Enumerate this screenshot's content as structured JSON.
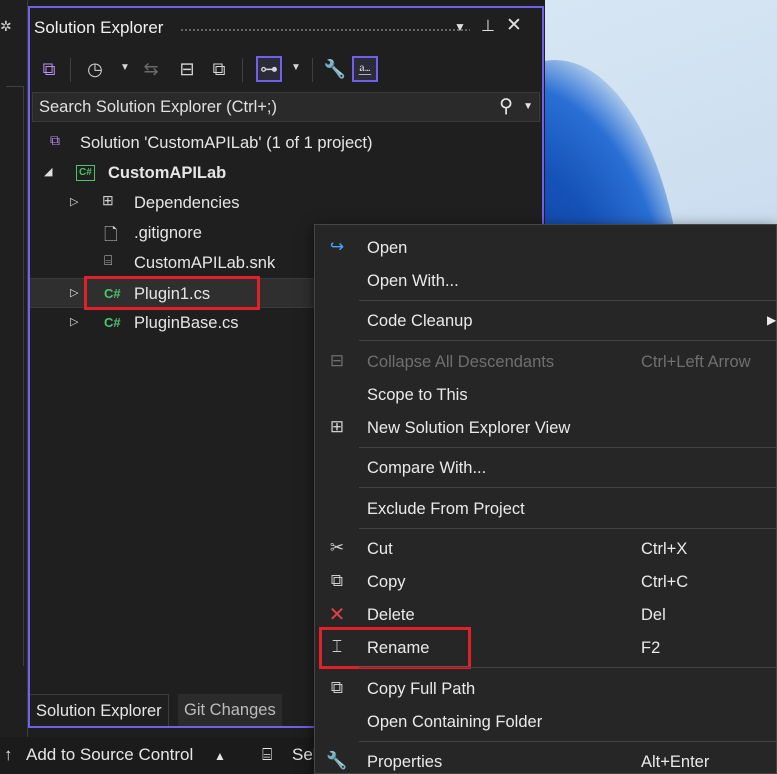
{
  "panel": {
    "title": "Solution Explorer",
    "search_placeholder": "Search Solution Explorer (Ctrl+;)"
  },
  "tree": [
    {
      "label": "Solution 'CustomAPILab' (1 of 1 project)"
    },
    {
      "label": "CustomAPILab"
    },
    {
      "label": "Dependencies"
    },
    {
      "label": ".gitignore"
    },
    {
      "label": "CustomAPILab.snk"
    },
    {
      "label": "Plugin1.cs"
    },
    {
      "label": "PluginBase.cs"
    }
  ],
  "tabs": [
    "Solution Explorer",
    "Git Changes"
  ],
  "status": {
    "add_source": "Add to Source Control",
    "select_repo": "Sel"
  },
  "menu": {
    "open": "Open",
    "open_with": "Open With...",
    "code_cleanup": "Code Cleanup",
    "collapse_all": "Collapse All Descendants",
    "collapse_all_sc": "Ctrl+Left Arrow",
    "scope": "Scope to This",
    "new_view": "New Solution Explorer View",
    "compare": "Compare With...",
    "exclude": "Exclude From Project",
    "cut": "Cut",
    "cut_sc": "Ctrl+X",
    "copy": "Copy",
    "copy_sc": "Ctrl+C",
    "delete": "Delete",
    "delete_sc": "Del",
    "rename": "Rename",
    "rename_sc": "F2",
    "copy_path": "Copy Full Path",
    "open_folder": "Open Containing Folder",
    "properties": "Properties",
    "properties_sc": "Alt+Enter"
  },
  "colors": {
    "accent": "#7160e8",
    "highlight": "#e0202a",
    "csharp": "#4ec26e"
  }
}
